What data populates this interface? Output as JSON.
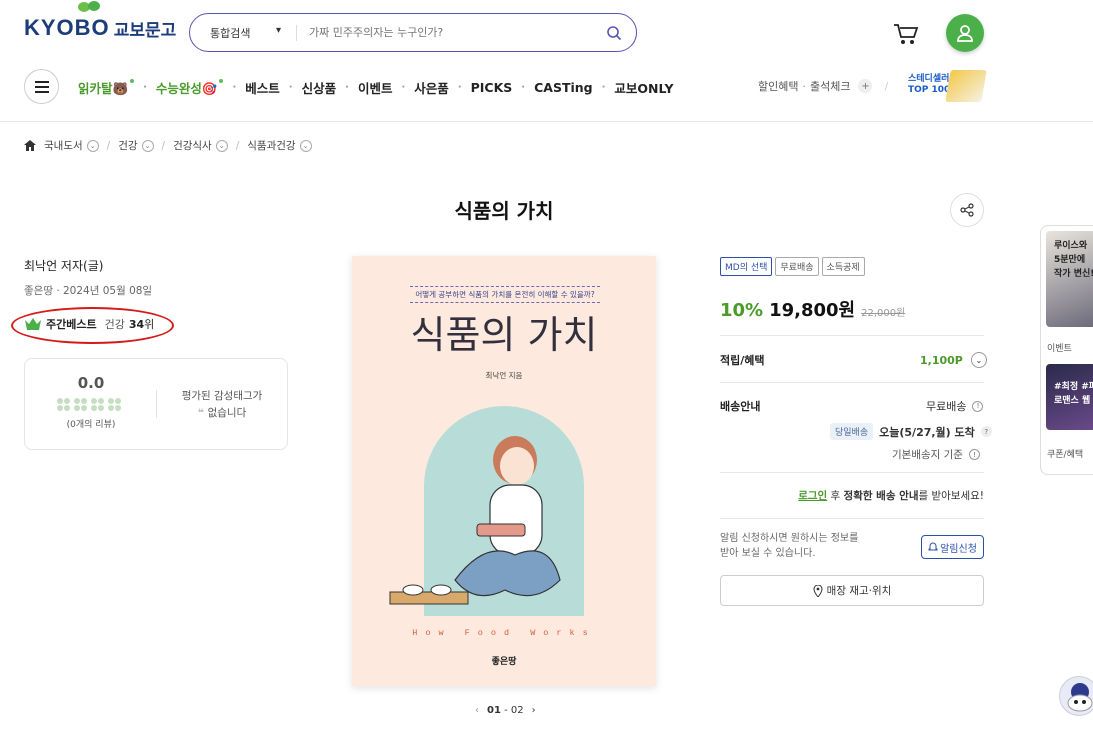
{
  "header": {
    "logo_en": "KYOBO",
    "logo_ko": "교보문고",
    "search_category": "통합검색",
    "search_placeholder": "가짜 민주주의자는 누구인가?"
  },
  "gnb": {
    "items": [
      "읽카탈🐻",
      "수능완성🎯",
      "베스트",
      "신상품",
      "이벤트",
      "사은품",
      "PICKS",
      "CASTing",
      "교보ONLY"
    ],
    "util": [
      "할인혜택",
      "출석체크"
    ],
    "study_line1": "스테디셀러",
    "study_line2": "TOP 100"
  },
  "breadcrumb": [
    "국내도서",
    "건강",
    "건강식사",
    "식품과건강"
  ],
  "product": {
    "title": "식품의 가치",
    "author": "최낙언 저자(글)",
    "publisher_date": "좋은땅 · 2024년 05월 08일",
    "rank_label": "주간베스트",
    "rank_category": "건강",
    "rank_num": "34",
    "rank_suffix": "위",
    "rating": "0.0",
    "review_count": "(0개의 리뷰)",
    "tag_line1": "평가된 감성태그가",
    "tag_line2": "없습니다"
  },
  "cover": {
    "subtitle": "어떻게 공부하면 식품의 가치를 온전히 이해할 수 있을까?",
    "title": "식품의 가치",
    "author": "최낙언 지음",
    "en_title": "How Food Works",
    "publisher": "좋은땅"
  },
  "pager": {
    "current": "01",
    "total": "02",
    "sep": "-"
  },
  "purchase": {
    "badges": [
      "MD의 선택",
      "무료배송",
      "소득공제"
    ],
    "discount": "10%",
    "price": "19,800원",
    "original_price": "22,000원",
    "points_label": "적립/혜택",
    "points_value": "1,100P",
    "shipping_label": "배송안내",
    "shipping_free": "무료배송",
    "same_day_badge": "당일배송",
    "arrival": "오늘(5/27,월) 도착",
    "base_address": "기본배송지 기준",
    "login_link": "로그인",
    "login_mid": " 후 ",
    "login_bold": "정확한 배송 안내",
    "login_end": "를 받아보세요!",
    "alarm_line1": "알림 신청하시면 원하시는 정보를",
    "alarm_line2": "받아 보실 수 있습니다.",
    "alarm_button": "알림신청",
    "store_button": "매장 재고·위치"
  },
  "side": {
    "banner1_line1": "루이스와",
    "banner1_line2": "5분만에",
    "banner1_line3": "작가 변신!",
    "label1": "이벤트",
    "banner2_line1": "#최정 #파",
    "banner2_line2": "로맨스 웹",
    "label2": "쿠폰/혜택"
  },
  "colors": {
    "brand": "#1c3d7a",
    "green": "#4a9b2c",
    "search_border": "#5a55b3",
    "highlight": "#d51a1a"
  }
}
